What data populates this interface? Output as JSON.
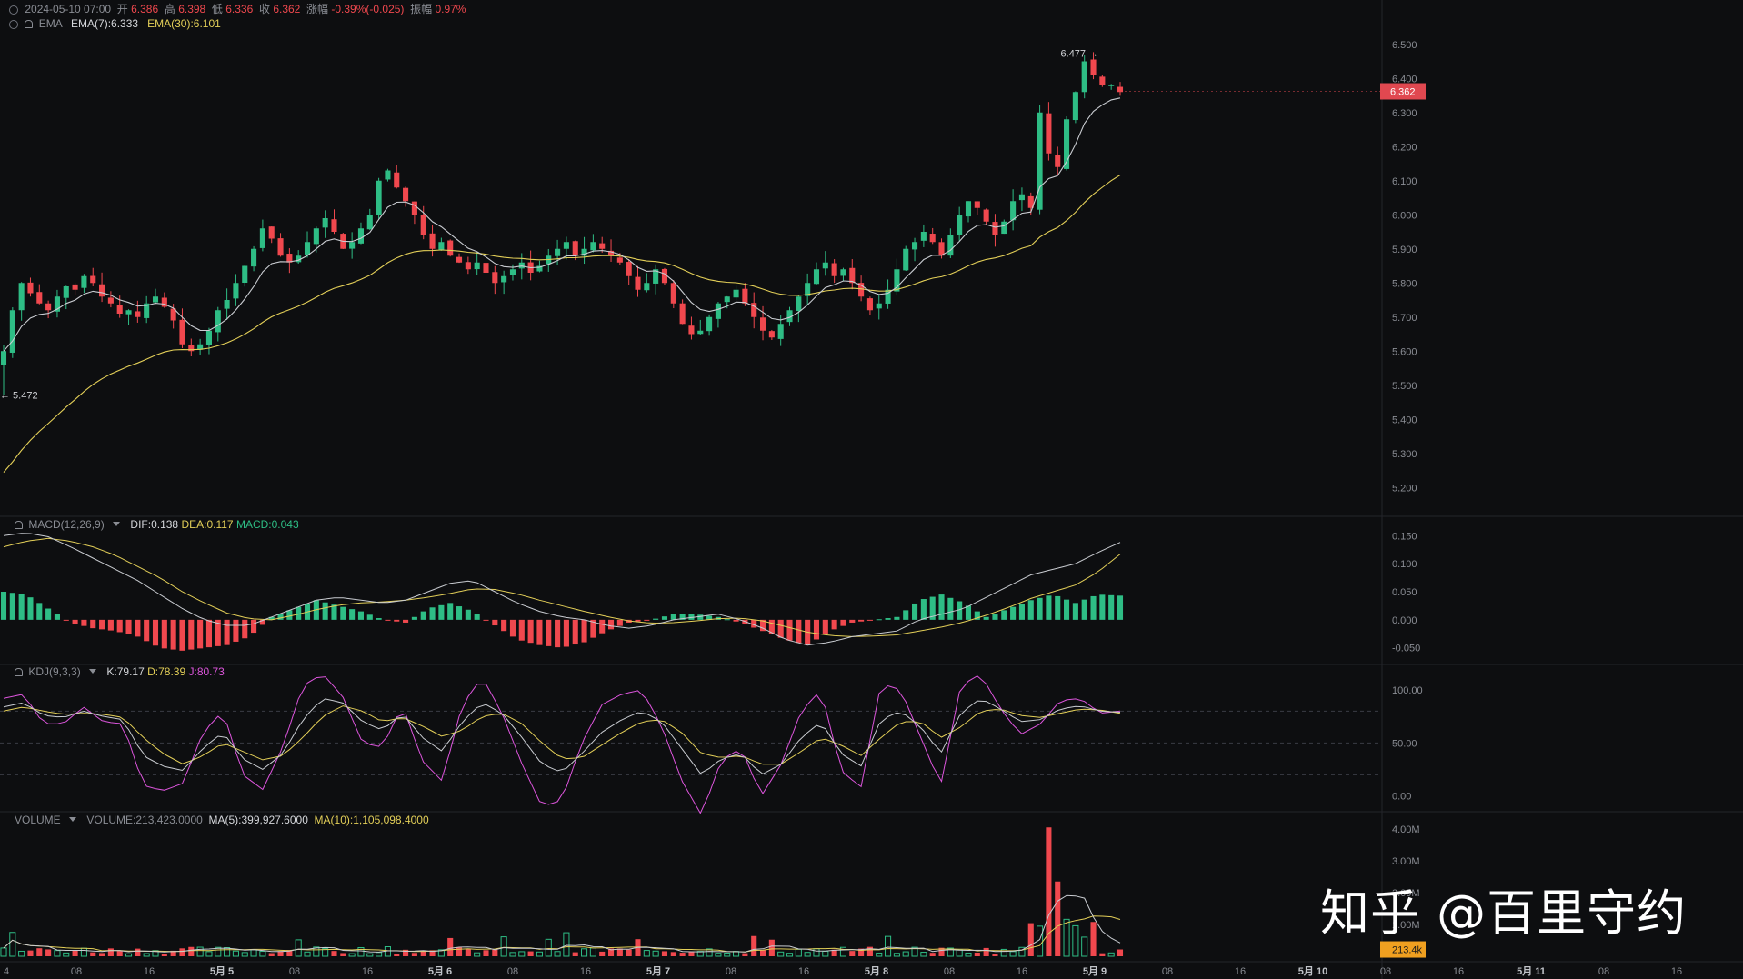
{
  "header": {
    "datetime": "2024-05-10 07:00",
    "open_label": "开",
    "open_value": "6.386",
    "high_label": "高",
    "high_value": "6.398",
    "low_label": "低",
    "low_value": "6.336",
    "close_label": "收",
    "close_value": "6.362",
    "change_label": "涨幅",
    "change_value": "-0.39%(-0.025)",
    "amplitude_label": "振幅",
    "amplitude_value": "0.97%"
  },
  "ema": {
    "name": "EMA",
    "ema7": "EMA(7):6.333",
    "ema30": "EMA(30):6.101"
  },
  "macd": {
    "name": "MACD(12,26,9)",
    "dif": "DIF:0.138",
    "dea": "DEA:0.117",
    "macd": "MACD:0.043"
  },
  "kdj": {
    "name": "KDJ(9,3,3)",
    "k": "K:79.17",
    "d": "D:78.39",
    "j": "J:80.73"
  },
  "volume": {
    "name": "VOLUME",
    "vol": "VOLUME:213,423.0000",
    "ma5": "MA(5):399,927.6000",
    "ma10": "MA(10):1,105,098.4000"
  },
  "price_markers": {
    "high_label": "6.477 →",
    "low_label": "← 5.472",
    "last_price": "6.362",
    "last_volume": "213.4k"
  },
  "watermark": "知乎 @百里守约",
  "colors": {
    "up": "#2ebd85",
    "down": "#f0484e",
    "ema7": "#c9ccd1",
    "ema30": "#e3cf58",
    "kdj_j": "#dd55dd",
    "background": "#0d0e10",
    "price_tag": "#e04850",
    "volume_tag": "#f0a020"
  },
  "chart_data": [
    {
      "type": "candlestick",
      "title": "",
      "xlabel": "",
      "ylabel": "",
      "ylim": [
        5.15,
        6.55
      ],
      "yticks": [
        5.2,
        5.3,
        5.4,
        5.5,
        5.6,
        5.7,
        5.8,
        5.9,
        6.0,
        6.1,
        6.2,
        6.3,
        6.4,
        6.5
      ],
      "x_ticks": [
        "4",
        "08",
        "16",
        "5月 5",
        "08",
        "16",
        "5月 6",
        "08",
        "16",
        "5月 7",
        "08",
        "16",
        "5月 8",
        "08",
        "16",
        "5月 9",
        "08",
        "16",
        "5月 10",
        "08",
        "16",
        "5月 11",
        "08",
        "16"
      ],
      "close_path": [
        5.6,
        5.72,
        5.8,
        5.77,
        5.74,
        5.72,
        5.76,
        5.79,
        5.78,
        5.82,
        5.8,
        5.76,
        5.74,
        5.71,
        5.72,
        5.7,
        5.74,
        5.76,
        5.73,
        5.69,
        5.62,
        5.6,
        5.62,
        5.66,
        5.72,
        5.75,
        5.8,
        5.85,
        5.9,
        5.96,
        5.93,
        5.88,
        5.86,
        5.88,
        5.92,
        5.96,
        5.99,
        5.95,
        5.9,
        5.92,
        5.96,
        6.0,
        6.1,
        6.13,
        6.08,
        6.04,
        6.0,
        5.94,
        5.9,
        5.92,
        5.88,
        5.86,
        5.84,
        5.86,
        5.83,
        5.8,
        5.82,
        5.84,
        5.86,
        5.83,
        5.85,
        5.88,
        5.9,
        5.92,
        5.88,
        5.9,
        5.92,
        5.9,
        5.88,
        5.86,
        5.82,
        5.78,
        5.8,
        5.84,
        5.8,
        5.74,
        5.68,
        5.65,
        5.66,
        5.7,
        5.74,
        5.76,
        5.78,
        5.74,
        5.7,
        5.66,
        5.64,
        5.68,
        5.72,
        5.76,
        5.8,
        5.84,
        5.86,
        5.82,
        5.84,
        5.8,
        5.76,
        5.72,
        5.74,
        5.78,
        5.84,
        5.9,
        5.92,
        5.95,
        5.92,
        5.88,
        5.94,
        6.0,
        6.04,
        6.02,
        5.98,
        5.94,
        5.98,
        6.04,
        6.06,
        6.02,
        6.3,
        6.18,
        6.14,
        6.28,
        6.36,
        6.45,
        6.41,
        6.38,
        6.38,
        6.36
      ],
      "range_high": 6.477,
      "range_low": 5.472,
      "last_price": 6.362,
      "ema7_last": 6.333,
      "ema30_last": 6.101
    },
    {
      "type": "bar+line",
      "title": "MACD(12,26,9)",
      "ylim": [
        -0.065,
        0.165
      ],
      "yticks": [
        -0.05,
        0.0,
        0.05,
        0.1,
        0.15
      ],
      "series": [
        {
          "name": "DIF",
          "last": 0.138
        },
        {
          "name": "DEA",
          "last": 0.117
        },
        {
          "name": "MACD",
          "last": 0.043
        }
      ],
      "dif_path": [
        0.15,
        0.155,
        0.148,
        0.13,
        0.11,
        0.09,
        0.07,
        0.045,
        0.02,
        0.0,
        -0.01,
        -0.01,
        0.005,
        0.02,
        0.035,
        0.04,
        0.035,
        0.03,
        0.035,
        0.05,
        0.065,
        0.07,
        0.05,
        0.03,
        0.015,
        0.005,
        0.0,
        -0.01,
        -0.015,
        -0.01,
        0.0,
        0.005,
        0.01,
        0.0,
        -0.015,
        -0.035,
        -0.045,
        -0.04,
        -0.03,
        -0.025,
        -0.02,
        0.0,
        0.01,
        0.02,
        0.04,
        0.06,
        0.08,
        0.09,
        0.1,
        0.12,
        0.138
      ],
      "dea_path": [
        0.13,
        0.14,
        0.145,
        0.14,
        0.13,
        0.115,
        0.095,
        0.075,
        0.05,
        0.03,
        0.012,
        0.002,
        0.0,
        0.008,
        0.018,
        0.026,
        0.03,
        0.032,
        0.035,
        0.04,
        0.047,
        0.055,
        0.054,
        0.046,
        0.035,
        0.025,
        0.015,
        0.006,
        -0.002,
        -0.006,
        -0.005,
        -0.002,
        0.002,
        0.003,
        -0.002,
        -0.012,
        -0.022,
        -0.028,
        -0.03,
        -0.029,
        -0.027,
        -0.02,
        -0.013,
        -0.004,
        0.008,
        0.022,
        0.038,
        0.05,
        0.062,
        0.085,
        0.117
      ],
      "hist_path": [
        0.05,
        0.045,
        0.02,
        -0.005,
        -0.015,
        -0.02,
        -0.03,
        -0.05,
        -0.055,
        -0.05,
        -0.045,
        -0.03,
        0.005,
        0.02,
        0.035,
        0.025,
        0.015,
        0.0,
        -0.005,
        0.02,
        0.03,
        0.015,
        -0.01,
        -0.035,
        -0.045,
        -0.05,
        -0.04,
        -0.02,
        -0.005,
        0.0,
        0.01,
        0.01,
        0.005,
        -0.005,
        -0.02,
        -0.035,
        -0.045,
        -0.02,
        -0.005,
        0.0,
        0.005,
        0.035,
        0.045,
        0.03,
        0.005,
        0.02,
        0.035,
        0.045,
        0.03,
        0.045,
        0.043
      ]
    },
    {
      "type": "line",
      "title": "KDJ(9,3,3)",
      "ylim": [
        -8,
        112
      ],
      "yticks": [
        0,
        50,
        100
      ],
      "series": [
        {
          "name": "K",
          "last": 79.17
        },
        {
          "name": "D",
          "last": 78.39
        },
        {
          "name": "J",
          "last": 80.73
        }
      ],
      "k_path": [
        84,
        88,
        76,
        74,
        80,
        75,
        72,
        38,
        28,
        24,
        45,
        60,
        35,
        25,
        40,
        72,
        92,
        88,
        70,
        62,
        78,
        55,
        42,
        70,
        88,
        78,
        55,
        30,
        22,
        40,
        60,
        72,
        80,
        70,
        45,
        20,
        35,
        40,
        20,
        30,
        55,
        70,
        40,
        28,
        72,
        80,
        65,
        40,
        78,
        92,
        82,
        70,
        72,
        82,
        85,
        80,
        79
      ],
      "d_path": [
        80,
        84,
        80,
        77,
        78,
        77,
        74,
        55,
        40,
        30,
        38,
        50,
        42,
        34,
        38,
        55,
        75,
        85,
        80,
        70,
        74,
        66,
        56,
        62,
        75,
        78,
        68,
        50,
        35,
        36,
        48,
        60,
        70,
        72,
        60,
        40,
        36,
        38,
        30,
        30,
        42,
        55,
        48,
        38,
        55,
        70,
        70,
        55,
        65,
        80,
        82,
        76,
        74,
        78,
        82,
        81,
        78
      ],
      "j_path": [
        92,
        96,
        68,
        68,
        84,
        70,
        68,
        10,
        5,
        12,
        60,
        80,
        20,
        6,
        46,
        104,
        115,
        94,
        50,
        46,
        86,
        33,
        14,
        86,
        112,
        78,
        30,
        -10,
        -4,
        50,
        86,
        96,
        100,
        66,
        15,
        -18,
        34,
        45,
        0,
        30,
        80,
        100,
        24,
        8,
        106,
        100,
        55,
        10,
        104,
        115,
        82,
        58,
        68,
        90,
        92,
        78,
        80
      ]
    },
    {
      "type": "bar+line",
      "title": "VOLUME",
      "ylim": [
        0,
        4200000
      ],
      "yticks": [
        1000000,
        2000000,
        3000000,
        4000000
      ],
      "ytick_labels": [
        "1.00M",
        "2.00M",
        "3.00M",
        "4.00M"
      ],
      "series": [
        {
          "name": "VOLUME",
          "last": 213423
        },
        {
          "name": "MA(5)",
          "last": 399927.6
        },
        {
          "name": "MA(10)",
          "last": 1105098.4
        }
      ],
      "peak_volume": 4050000
    }
  ]
}
